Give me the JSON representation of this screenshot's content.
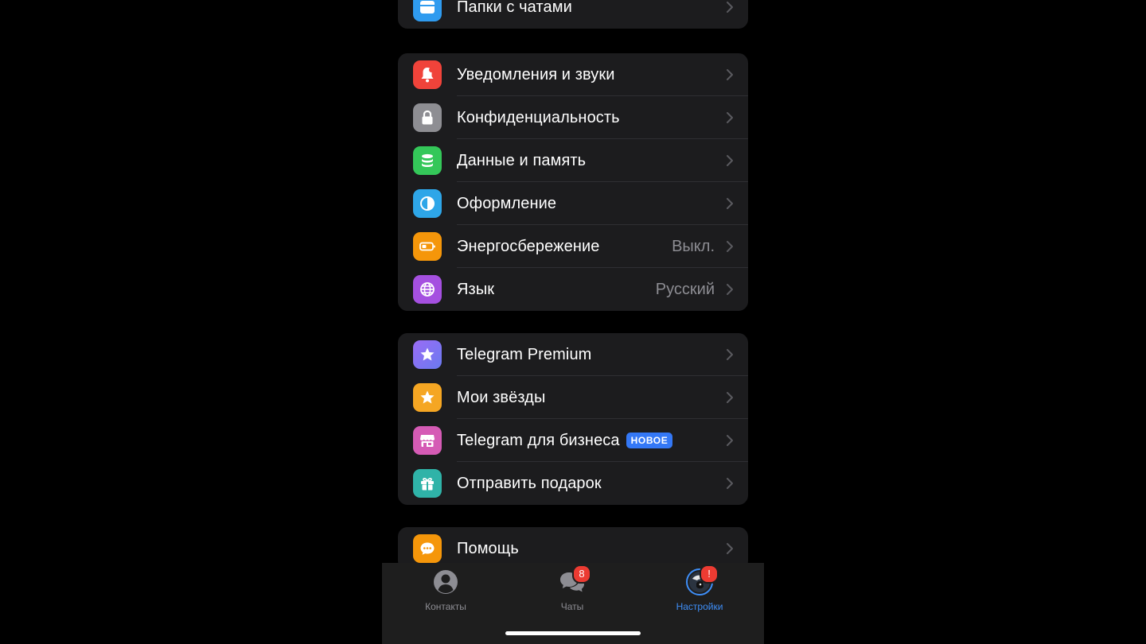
{
  "colors": {
    "background": "#000000",
    "group_bg": "#1c1c1e",
    "accent": "#3e8ef7",
    "badge_red": "#ec3b32",
    "new_badge": "#3478f6"
  },
  "groups": [
    {
      "items": [
        {
          "label": "Папки с чатами",
          "icon": "folder-icon",
          "icon_color": "#2f9bef"
        }
      ]
    },
    {
      "items": [
        {
          "label": "Уведомления и звуки",
          "icon": "bell-icon",
          "icon_color": "#f0433a"
        },
        {
          "label": "Конфиденциальность",
          "icon": "lock-icon",
          "icon_color": "#8e8e93"
        },
        {
          "label": "Данные и память",
          "icon": "database-icon",
          "icon_color": "#34c759"
        },
        {
          "label": "Оформление",
          "icon": "half-circle-icon",
          "icon_color": "#2ea6e8"
        },
        {
          "label": "Энергосбережение",
          "value": "Выкл.",
          "icon": "battery-icon",
          "icon_color": "#f5960a"
        },
        {
          "label": "Язык",
          "value": "Русский",
          "icon": "globe-icon",
          "icon_color": "#a550e0"
        }
      ]
    },
    {
      "items": [
        {
          "label": "Telegram Premium",
          "icon": "star-premium-icon",
          "icon_color": "#7b6cf0"
        },
        {
          "label": "Мои звёзды",
          "icon": "star-icon",
          "icon_color": "#f5a623"
        },
        {
          "label": "Telegram для бизнеса",
          "badge": "НОВОЕ",
          "icon": "store-icon",
          "icon_color": "#d55bb5"
        },
        {
          "label": "Отправить подарок",
          "icon": "gift-icon",
          "icon_color": "#2fb3a8"
        }
      ]
    },
    {
      "items": [
        {
          "label": "Помощь",
          "icon": "chat-bubble-icon",
          "icon_color": "#f5960a"
        }
      ]
    }
  ],
  "tabbar": {
    "tabs": [
      {
        "label": "Контакты",
        "icon": "person-circle-icon"
      },
      {
        "label": "Чаты",
        "icon": "chats-icon",
        "badge": "8"
      },
      {
        "label": "Настройки",
        "icon": "avatar-icon",
        "badge": "!",
        "active": true
      }
    ]
  }
}
